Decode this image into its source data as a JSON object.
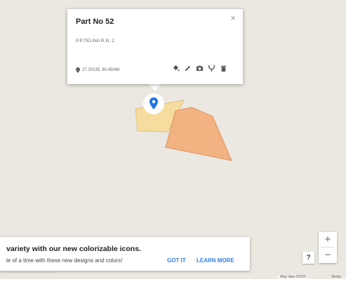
{
  "info_window": {
    "title": "Part No 52",
    "description": "P.P.TELINA R.N. 2",
    "coordinates": "27.20135, 80.45068",
    "close_symbol": "×",
    "tools": [
      "paint-bucket-icon",
      "pencil-icon",
      "camera-icon",
      "route-icon",
      "trash-icon"
    ]
  },
  "polygons": [
    {
      "name": "parcel-yellow",
      "fill": "#f7dc9c",
      "stroke": "#e2c27a"
    },
    {
      "name": "parcel-orange",
      "fill": "#f3b07d",
      "stroke": "#df8f55"
    }
  ],
  "marker": {
    "color": "#1a73e8"
  },
  "promo": {
    "title": "variety with our new colorizable icons.",
    "text": "le of a time with these new designs and colors!",
    "got_it": "GOT IT",
    "learn_more": "LEARN MORE"
  },
  "controls": {
    "help": "?",
    "zoom_in": "+",
    "zoom_out": "−"
  },
  "attribution": {
    "map_data": "Map data ©2016",
    "terms": "Terms"
  }
}
